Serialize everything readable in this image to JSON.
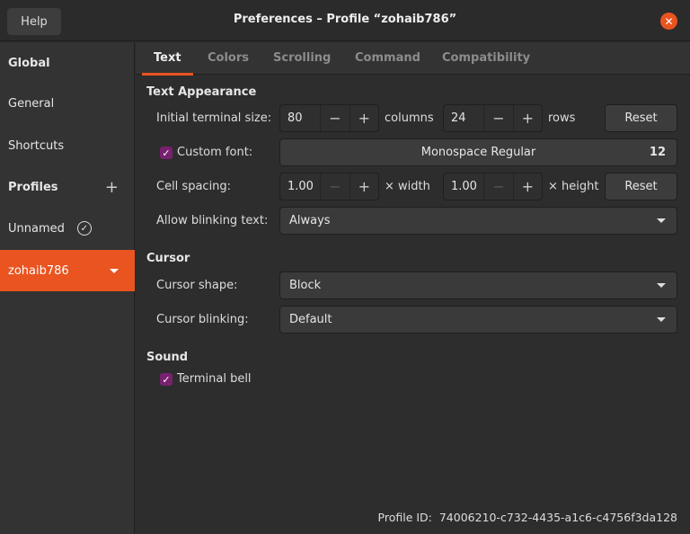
{
  "window": {
    "title": "Preferences – Profile “zohaib786”",
    "help_label": "Help"
  },
  "sidebar": {
    "global": "Global",
    "general": "General",
    "shortcuts": "Shortcuts",
    "profiles": "Profiles",
    "profile_items": [
      "Unnamed",
      "zohaib786"
    ]
  },
  "tabs": [
    "Text",
    "Colors",
    "Scrolling",
    "Command",
    "Compatibility"
  ],
  "text_appearance": {
    "heading": "Text Appearance",
    "size_label": "Initial terminal size:",
    "columns": "80",
    "columns_unit": "columns",
    "rows": "24",
    "rows_unit": "rows",
    "reset": "Reset",
    "custom_font_label": "Custom font:",
    "custom_font_checked": true,
    "font_name": "Monospace Regular",
    "font_size": "12",
    "cell_spacing_label": "Cell spacing:",
    "width": "1.00",
    "width_unit": "× width",
    "height": "1.00",
    "height_unit": "× height",
    "blink_label": "Allow blinking text:",
    "blink_value": "Always"
  },
  "cursor": {
    "heading": "Cursor",
    "shape_label": "Cursor shape:",
    "shape_value": "Block",
    "blinking_label": "Cursor blinking:",
    "blinking_value": "Default"
  },
  "sound": {
    "heading": "Sound",
    "bell_label": "Terminal bell",
    "bell_checked": true
  },
  "footer": {
    "profile_id_label": "Profile ID:",
    "profile_id": "74006210-c732-4435-a1c6-c4756f3da128"
  },
  "colors": {
    "accent": "#e95420",
    "checkbox": "#77216f"
  }
}
